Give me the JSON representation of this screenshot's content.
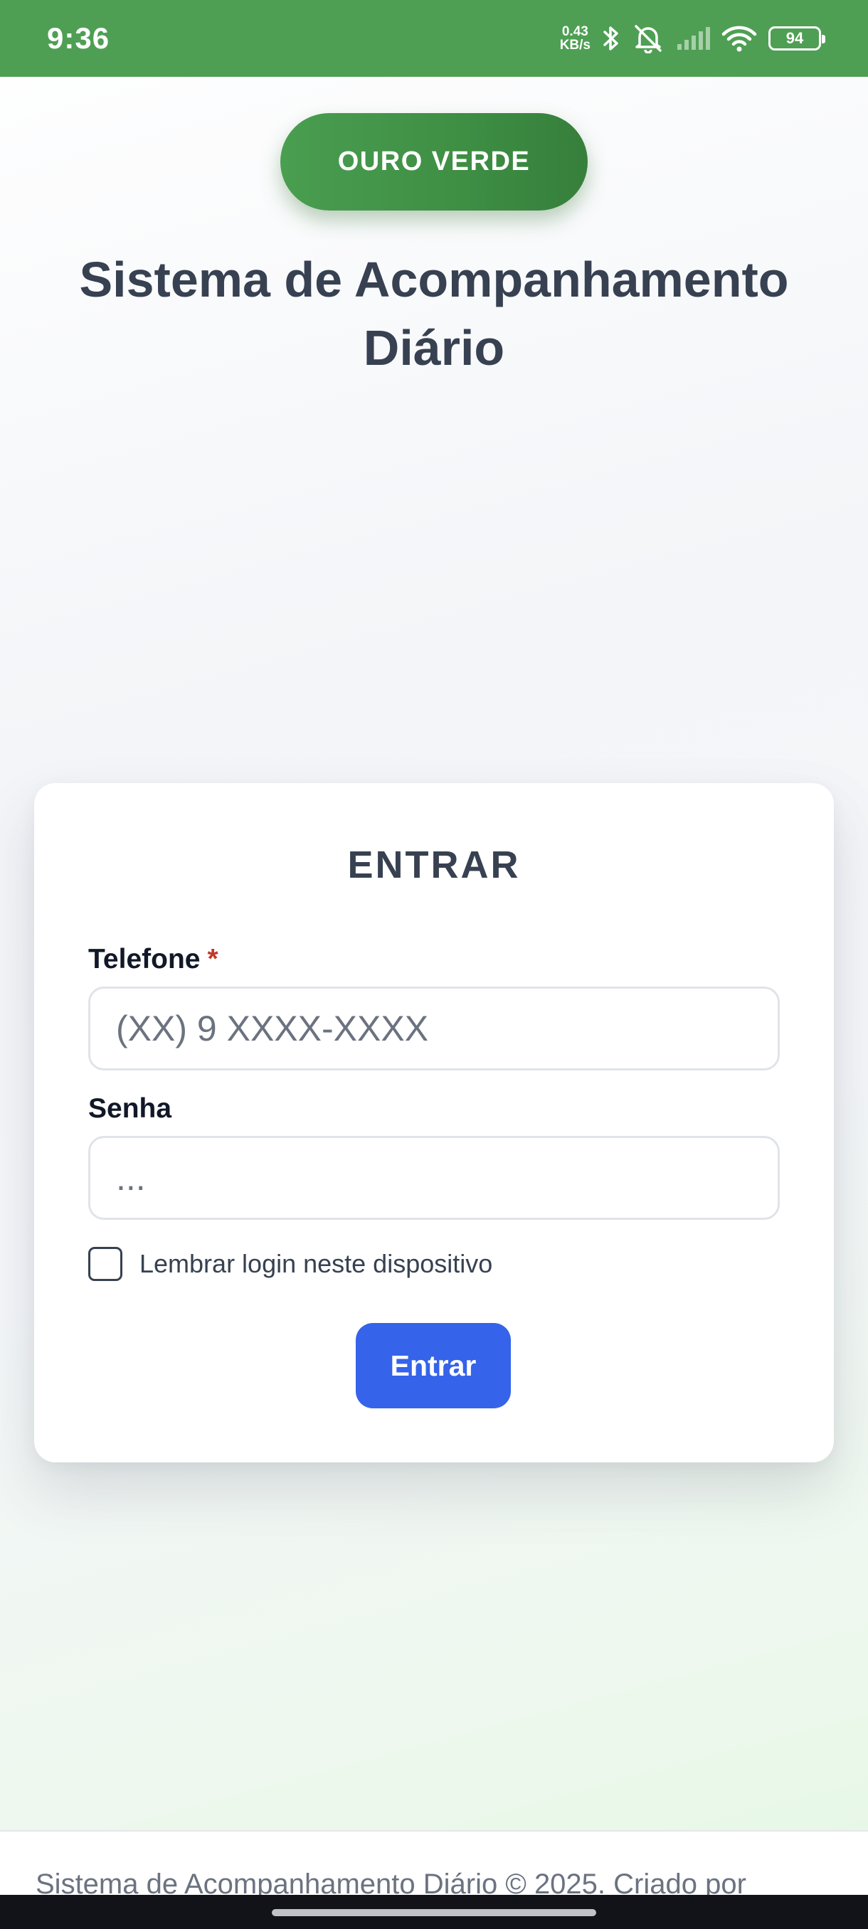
{
  "status_bar": {
    "time": "9:36",
    "net_speed_value": "0.43",
    "net_speed_unit": "KB/s",
    "battery_level": "94",
    "icons": [
      "bluetooth-icon",
      "bell-muted-icon",
      "cell-signal-icon",
      "wifi-icon",
      "battery-icon"
    ],
    "background_color": "#4e9f53"
  },
  "brand": {
    "label": "OURO VERDE",
    "color": "#43964a"
  },
  "page": {
    "title": "Sistema de Acompanhamento Diário"
  },
  "login_form": {
    "title": "ENTRAR",
    "phone": {
      "label": "Telefone",
      "required_marker": "*",
      "placeholder": "(XX) 9 XXXX-XXXX",
      "value": ""
    },
    "password": {
      "label": "Senha",
      "placeholder": "...",
      "value": ""
    },
    "remember": {
      "label": "Lembrar login neste dispositivo",
      "checked": false
    },
    "submit_label": "Entrar",
    "submit_color": "#3563e9"
  },
  "footer": {
    "text": "Sistema de Acompanhamento Diário © 2025. Criado por"
  }
}
